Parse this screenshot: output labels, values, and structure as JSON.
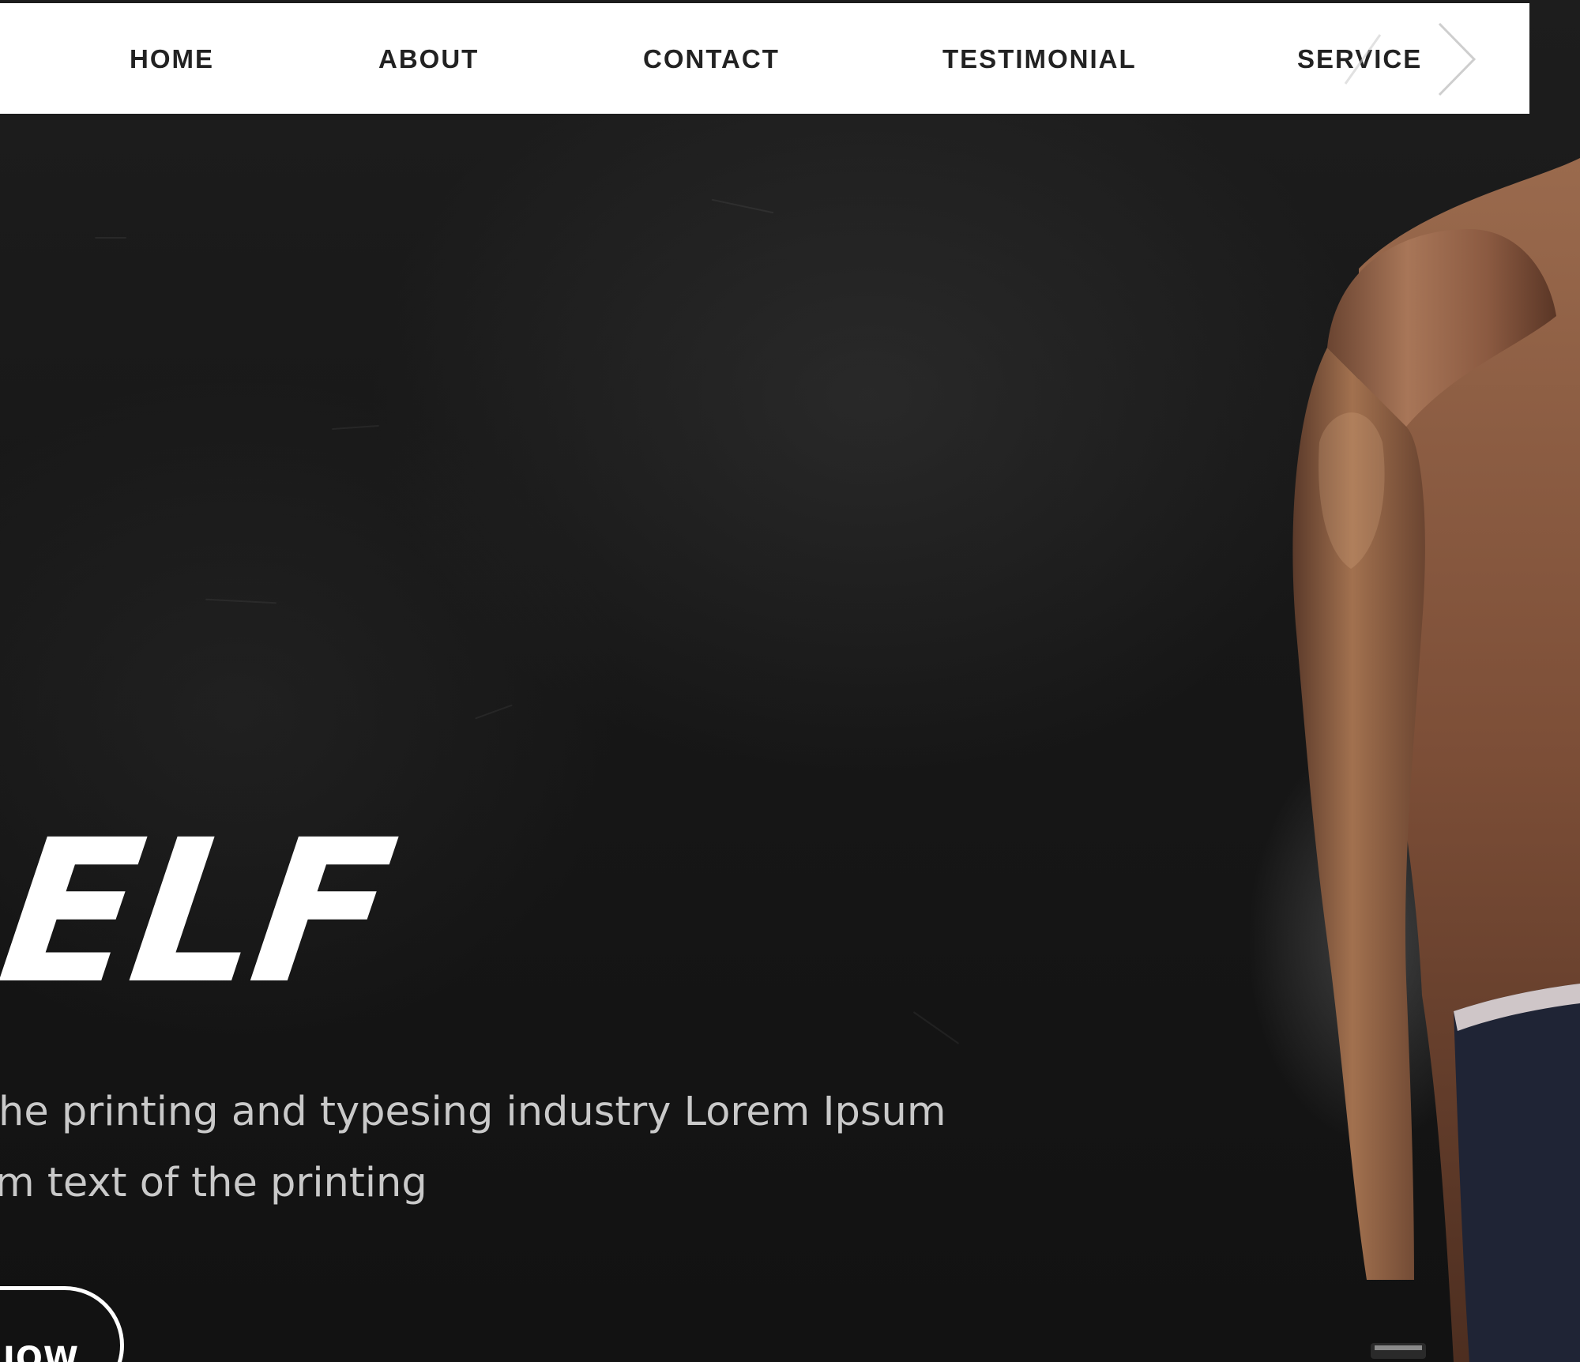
{
  "nav": {
    "items": [
      {
        "label": "HOME"
      },
      {
        "label": "ABOUT"
      },
      {
        "label": "CONTACT"
      },
      {
        "label": "TESTIMONIAL"
      },
      {
        "label": "SERVICE"
      }
    ]
  },
  "carousel": {
    "prev_icon": "chevron-left-icon",
    "next_icon": "chevron-right-icon"
  },
  "hero": {
    "title": "ELF",
    "text_line_1": "he printing and typesing industry Lorem Ipsum",
    "text_line_2": "m text of the printing",
    "button_label": "IOW",
    "image_subject": "muscular shirtless man"
  },
  "colors": {
    "background": "#171717",
    "nav_background": "#ffffff",
    "nav_text": "#222222",
    "hero_text": "#c9c9c9",
    "accent": "#ffffff"
  }
}
